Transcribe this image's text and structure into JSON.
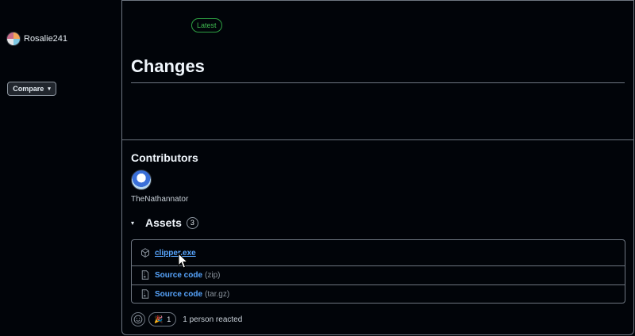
{
  "sidebar": {
    "username": "Rosalie241",
    "compare_label": "Compare",
    "caret": "▾"
  },
  "release": {
    "badge": "Latest",
    "title": "Changes"
  },
  "contributors": {
    "title": "Contributors",
    "items": [
      {
        "name": "TheNathannator"
      }
    ]
  },
  "assets": {
    "title": "Assets",
    "count": "3",
    "toggle": "▾",
    "items": [
      {
        "name": "clipper.exe",
        "ext": "",
        "icon": "package-icon"
      },
      {
        "name": "Source code",
        "ext": "(zip)",
        "icon": "file-zip-icon"
      },
      {
        "name": "Source code",
        "ext": "(tar.gz)",
        "icon": "file-zip-icon"
      }
    ]
  },
  "reactions": {
    "emoji": "🎉",
    "count": "1",
    "summary": "1 person reacted"
  },
  "colors": {
    "background": "#010409",
    "link": "#58a6ff",
    "latest_badge": "#3fb950",
    "border": "#6e7681"
  }
}
